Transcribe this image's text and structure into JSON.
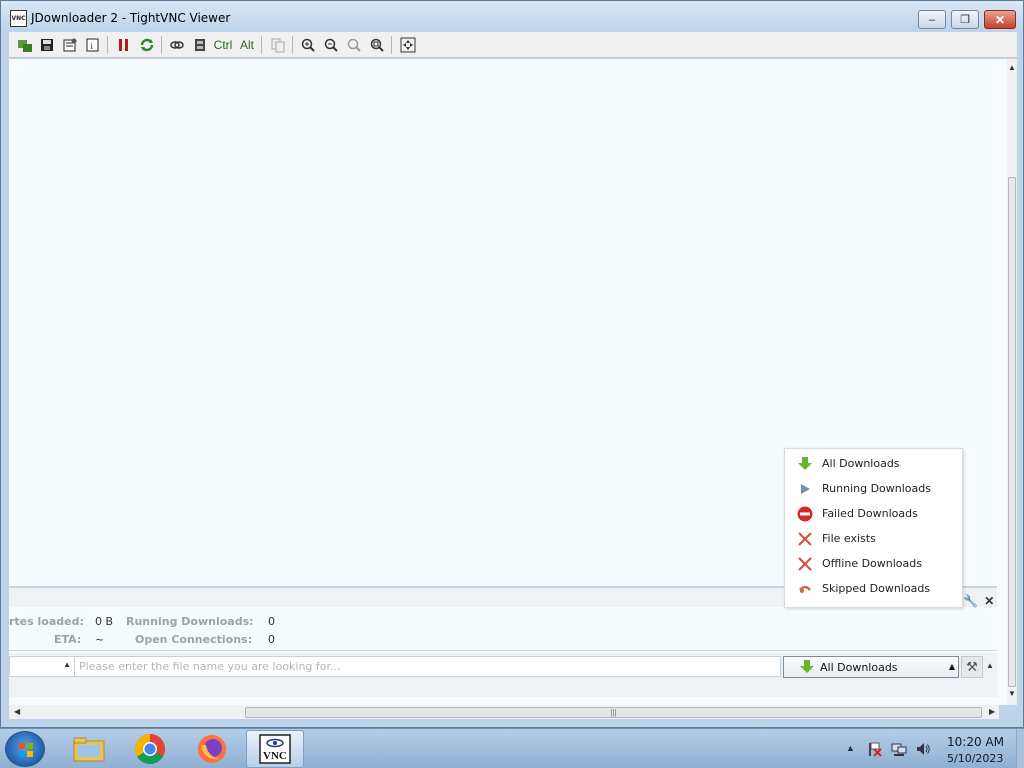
{
  "window": {
    "title": "JDownloader 2 - TightVNC Viewer",
    "icon_text": "VNC",
    "controls": {
      "minimize": "–",
      "maximize": "❐",
      "close": "✕"
    }
  },
  "toolbar": {
    "ctrl_label": "Ctrl",
    "alt_label": "Alt",
    "icons": [
      "new-connection-icon",
      "save-icon",
      "options-icon",
      "info-icon",
      "pause-icon",
      "refresh-icon",
      "transfer-files-icon",
      "full-control-icon",
      "ctrl-key-icon",
      "alt-key-icon",
      "copy-icon",
      "zoom-in-icon",
      "zoom-out-icon",
      "zoom-100-icon",
      "zoom-fit-icon",
      "fullscreen-icon"
    ]
  },
  "info_panel": {
    "bytes_loaded_label": "rtes loaded:",
    "bytes_loaded_value": "0 B",
    "running_label": "Running Downloads:",
    "running_value": "0",
    "eta_label": "ETA:",
    "eta_value": "~",
    "connections_label": "Open Connections:",
    "connections_value": "0"
  },
  "search": {
    "placeholder": "Please enter the file name you are looking for..."
  },
  "filter": {
    "selected": "All Downloads"
  },
  "popup_menu": {
    "items": [
      {
        "label": "All Downloads",
        "icon": "download-arrow-icon",
        "color": "#6ab42d"
      },
      {
        "label": "Running Downloads",
        "icon": "play-icon",
        "color": "#7a8fa8"
      },
      {
        "label": "Failed Downloads",
        "icon": "stop-icon",
        "color": "#d12a2a"
      },
      {
        "label": "File exists",
        "icon": "cross-icon",
        "color": "#d64b3b"
      },
      {
        "label": "Offline Downloads",
        "icon": "cross-icon",
        "color": "#d64b3b"
      },
      {
        "label": "Skipped Downloads",
        "icon": "skip-icon",
        "color": "#d2693c"
      }
    ]
  },
  "taskbar": {
    "apps": [
      "windows-explorer",
      "chrome",
      "firefox",
      "tightvnc-viewer"
    ],
    "clock_time": "10:20 AM",
    "clock_date": "5/10/2023"
  }
}
